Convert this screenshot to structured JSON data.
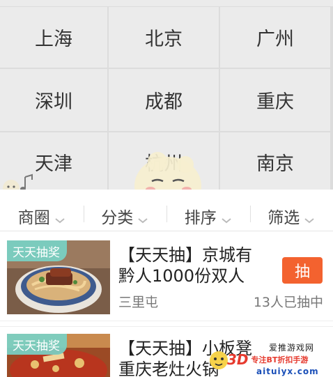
{
  "cities": [
    {
      "label": "上海"
    },
    {
      "label": "北京"
    },
    {
      "label": "广州"
    },
    {
      "label": "深圳"
    },
    {
      "label": "成都"
    },
    {
      "label": "重庆"
    },
    {
      "label": "天津"
    },
    {
      "label": "杭州"
    },
    {
      "label": "南京"
    }
  ],
  "filters": [
    {
      "label": "商圈"
    },
    {
      "label": "分类"
    },
    {
      "label": "排序"
    },
    {
      "label": "筛选"
    }
  ],
  "deals": [
    {
      "badge": "天天抽奖",
      "title": "【天天抽】京城有⁠\n⁠黔人1000份双人",
      "location": "三里屯",
      "count": "13人已抽中",
      "action": "抽",
      "icon": "noodle-bowl-photo"
    },
    {
      "badge": "天天抽奖",
      "title": "【天天抽】小板凳\n重庆老灶火锅",
      "icon": "hotpot-photo"
    }
  ],
  "watermark": {
    "site_cn": "爱推游戏网",
    "brand": "3D",
    "slogan": "专注BT折扣手游",
    "url": "aituiyx.com"
  },
  "colors": {
    "accent": "#f3622f",
    "badge": "#78d1c5",
    "grid_bg": "#ebebeb"
  }
}
